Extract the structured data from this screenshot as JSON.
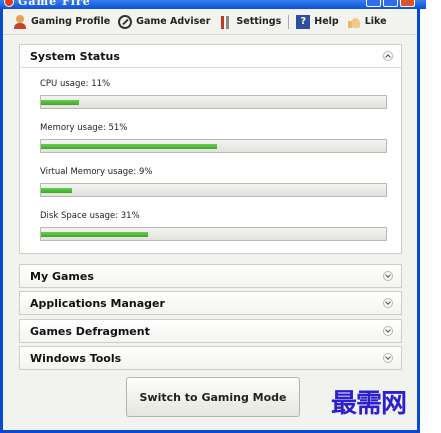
{
  "window": {
    "title": "Game Fire"
  },
  "toolbar": {
    "items": [
      {
        "label": "Gaming Profile",
        "icon": "user-icon"
      },
      {
        "label": "Game Adviser",
        "icon": "adviser-icon"
      },
      {
        "label": "Settings",
        "icon": "settings-icon"
      },
      {
        "label": "Help",
        "icon": "help-icon"
      },
      {
        "label": "Like",
        "icon": "thumbs-up-icon"
      }
    ]
  },
  "system_status": {
    "title": "System Status",
    "expanded": true,
    "metrics": [
      {
        "label": "CPU usage: 11%",
        "value": 0.11
      },
      {
        "label": "Memory usage: 51%",
        "value": 0.51
      },
      {
        "label": "Virtual Memory usage: 9%",
        "value": 0.09
      },
      {
        "label": "Disk Space usage: 31%",
        "value": 0.31
      }
    ]
  },
  "sections": [
    {
      "title": "My Games"
    },
    {
      "title": "Applications Manager"
    },
    {
      "title": "Games Defragment"
    },
    {
      "title": "Windows Tools"
    }
  ],
  "mode_button": {
    "label": "Switch to Gaming Mode"
  },
  "watermark": {
    "text": "最需网"
  },
  "colors": {
    "accent": "#0a4ad0",
    "progress": "#4cbb35",
    "watermark": "#2b1fd0"
  }
}
